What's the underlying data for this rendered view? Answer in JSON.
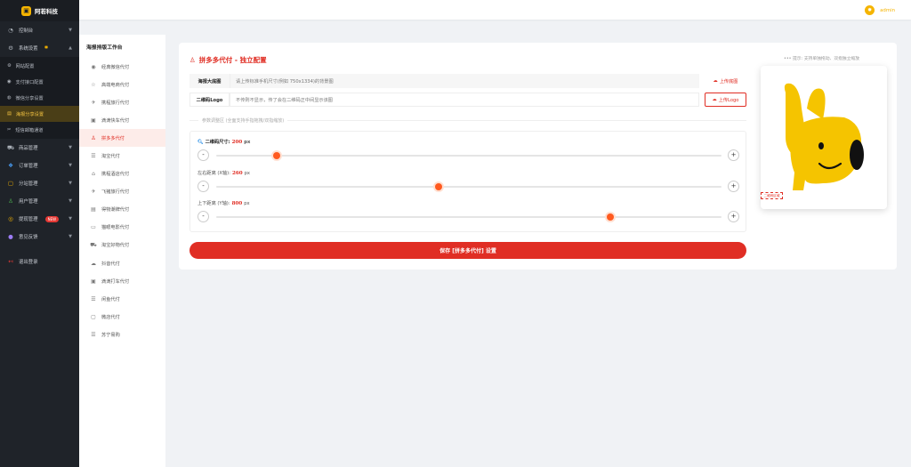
{
  "brand": {
    "name": "阿若科技"
  },
  "sidebar": {
    "items": [
      {
        "label": "控制台",
        "icon": "dashboard-icon"
      },
      {
        "label": "系统设置",
        "icon": "gear-icon"
      }
    ],
    "sub_items": [
      {
        "label": "网站配置",
        "icon": "gear-icon"
      },
      {
        "label": "支付接口配置",
        "icon": "pay-icon"
      },
      {
        "label": "微信分享设置",
        "icon": "share-icon"
      },
      {
        "label": "海报分享设置",
        "icon": "poster-icon",
        "active": true
      },
      {
        "label": "短信邮箱通道",
        "icon": "tool-icon"
      }
    ],
    "lower_items": [
      {
        "label": "商品管理",
        "icon": "cart-icon"
      },
      {
        "label": "订单管理",
        "icon": "order-icon"
      },
      {
        "label": "分站管理",
        "icon": "site-icon"
      },
      {
        "label": "用户管理",
        "icon": "user-icon"
      },
      {
        "label": "提现管理",
        "icon": "withdraw-icon",
        "badge": "NEW"
      },
      {
        "label": "意见反馈",
        "icon": "feedback-icon"
      },
      {
        "label": "退出登录",
        "icon": "logout-icon"
      }
    ]
  },
  "topbar": {
    "username": "admin"
  },
  "workbench": {
    "title": "海报排版工作台",
    "items": [
      {
        "label": "经典微信代付",
        "icon": "wechat-icon"
      },
      {
        "label": "高端电商代付",
        "icon": "star-icon"
      },
      {
        "label": "携程旅行代付",
        "icon": "plane-icon"
      },
      {
        "label": "滴滴快车代付",
        "icon": "image-icon"
      },
      {
        "label": "拼多多代付",
        "icon": "user-icon",
        "active": true
      },
      {
        "label": "淘宝代付",
        "icon": "list-icon"
      },
      {
        "label": "携程酒店代付",
        "icon": "home-icon"
      },
      {
        "label": "飞猪旅行代付",
        "icon": "plane-icon"
      },
      {
        "label": "得物潮牌代付",
        "icon": "doc-icon"
      },
      {
        "label": "猫眼电影代付",
        "icon": "ticket-icon"
      },
      {
        "label": "淘宝好物代付",
        "icon": "cart-icon"
      },
      {
        "label": "抖音代付",
        "icon": "cloud-icon"
      },
      {
        "label": "滴滴打车代付",
        "icon": "image-icon"
      },
      {
        "label": "闲鱼代付",
        "icon": "list-icon"
      },
      {
        "label": "微店代付",
        "icon": "shop-icon"
      },
      {
        "label": "苏宁易购",
        "icon": "list-icon"
      }
    ]
  },
  "config": {
    "title": "拼多多代付 - 独立配置",
    "hint": "••• 提示: 支持单独拖动、双指独立缩放",
    "bg": {
      "label": "海报大底图",
      "placeholder": "请上传标准手机尺寸(例如 750x1334)的背景图",
      "button": "上传底图"
    },
    "logo": {
      "label": "二维码Logo",
      "placeholder": "不传则不显示，传了会在二维码正中间显示该图",
      "button": "上传Logo"
    },
    "divider": "参数调整区 (全面支持手指拖拽/双指缩放)",
    "sliders": [
      {
        "label": "二维码尺寸:",
        "value": "200",
        "unit": "px",
        "fraction": 0.12
      },
      {
        "label": "左右距离 (X轴):",
        "value": "260",
        "unit": "px",
        "fraction": 0.44
      },
      {
        "label": "上下距离 (Y轴):",
        "value": "800",
        "unit": "px",
        "fraction": 0.78
      }
    ],
    "save_label": "保存 [拼多多代付] 设置",
    "qr_mark": "二维码区域"
  },
  "colors": {
    "accent": "#e02e24",
    "brand": "#f5b400",
    "sidebar": "#1f2329"
  }
}
